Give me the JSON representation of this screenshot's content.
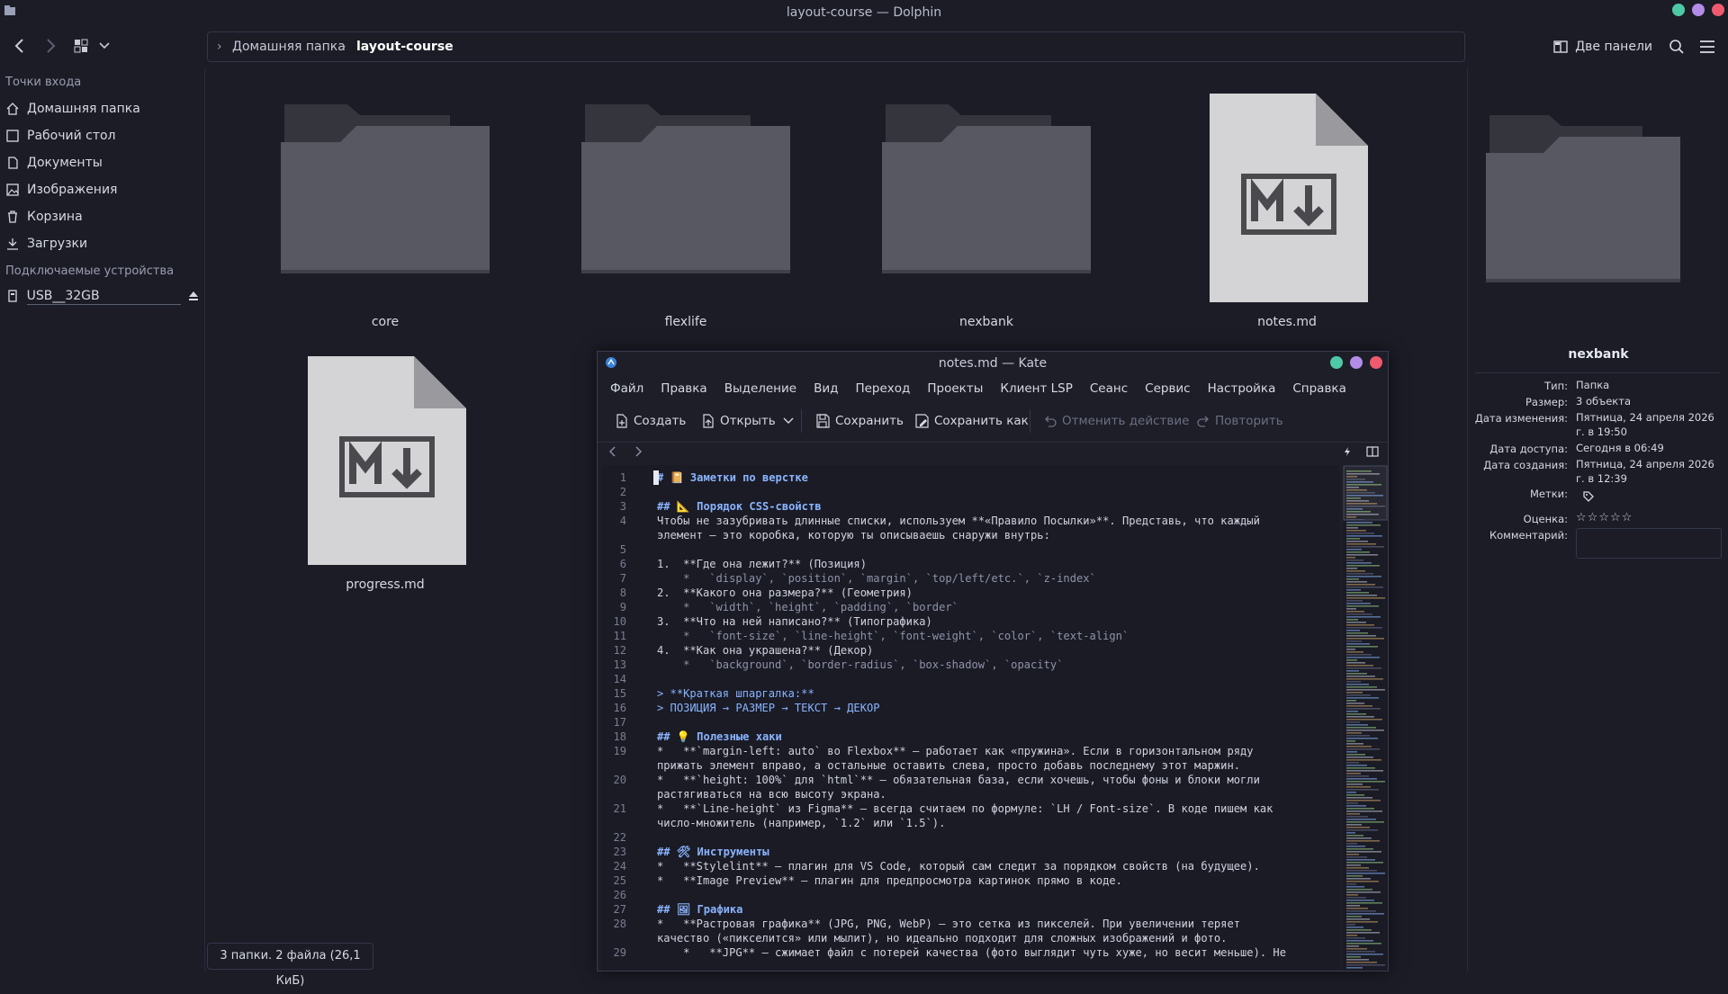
{
  "dolphin": {
    "title": "layout-course — Dolphin",
    "breadcrumb": [
      "Домашняя папка",
      "layout-course"
    ],
    "split_label": "Две панели",
    "sidebar": {
      "places_header": "Точки входа",
      "places": [
        "Домашняя папка",
        "Рабочий стол",
        "Документы",
        "Изображения",
        "Корзина",
        "Загрузки"
      ],
      "devices_header": "Подключаемые устройства",
      "devices": [
        "USB__32GB"
      ]
    },
    "files": [
      "core",
      "flexlife",
      "nexbank",
      "notes.md",
      "progress.md"
    ],
    "status": "3 папки. 2 файла (26,1 КиБ)",
    "info": {
      "name": "nexbank",
      "type_key": "Тип:",
      "type_val": "Папка",
      "size_key": "Размер:",
      "size_val": "3 объекта",
      "modified_key": "Дата изменения:",
      "modified_val": "Пятница, 24 апреля 2026 г. в 19:50",
      "accessed_key": "Дата доступа:",
      "accessed_val": "Сегодня в 06:49",
      "created_key": "Дата создания:",
      "created_val": "Пятница, 24 апреля 2026 г. в 12:39",
      "tags_key": "Метки:",
      "rating_key": "Оценка:",
      "rating": 0,
      "comment_key": "Комментарий:"
    }
  },
  "kate": {
    "title": "notes.md — Kate",
    "menu": [
      "Файл",
      "Правка",
      "Выделение",
      "Вид",
      "Переход",
      "Проекты",
      "Клиент LSP",
      "Сеанс",
      "Сервис",
      "Настройка",
      "Справка"
    ],
    "toolbar": {
      "new": "Создать",
      "open": "Открыть",
      "save": "Сохранить",
      "save_as": "Сохранить как",
      "undo": "Отменить действие",
      "redo": "Повторить"
    },
    "lines": [
      {
        "n": "1",
        "t": "# 📔 Заметки по верстке",
        "s": "h"
      },
      {
        "n": "2",
        "t": "",
        "s": ""
      },
      {
        "n": "3",
        "t": "## 📐 Порядок CSS-свойств",
        "s": "h"
      },
      {
        "n": "4",
        "t": "Чтобы не зазубривать длинные списки, используем **«Правило Посылки»**. Представь, что каждый",
        "s": ""
      },
      {
        "n": "",
        "t": "элемент — это коробка, которую ты описываешь снаружи внутрь:",
        "s": ""
      },
      {
        "n": "5",
        "t": "",
        "s": ""
      },
      {
        "n": "6",
        "t": "1.  **Где она лежит?** (Позиция)",
        "s": ""
      },
      {
        "n": "7",
        "t": "    *   `display`, `position`, `margin`, `top/left/etc.`, `z-index`",
        "s": "c"
      },
      {
        "n": "8",
        "t": "2.  **Какого она размера?** (Геометрия)",
        "s": ""
      },
      {
        "n": "9",
        "t": "    *   `width`, `height`, `padding`, `border`",
        "s": "c"
      },
      {
        "n": "10",
        "t": "3.  **Что на ней написано?** (Типографика)",
        "s": ""
      },
      {
        "n": "11",
        "t": "    *   `font-size`, `line-height`, `font-weight`, `color`, `text-align`",
        "s": "c"
      },
      {
        "n": "12",
        "t": "4.  **Как она украшена?** (Декор)",
        "s": ""
      },
      {
        "n": "13",
        "t": "    *   `background`, `border-radius`, `box-shadow`, `opacity`",
        "s": "c"
      },
      {
        "n": "14",
        "t": "",
        "s": ""
      },
      {
        "n": "15",
        "t": "> **Краткая шпаргалка:**",
        "s": "q"
      },
      {
        "n": "16",
        "t": "> ПОЗИЦИЯ → РАЗМЕР → ТЕКСТ → ДЕКОР",
        "s": "q"
      },
      {
        "n": "17",
        "t": "",
        "s": ""
      },
      {
        "n": "18",
        "t": "## 💡 Полезные хаки",
        "s": "h"
      },
      {
        "n": "19",
        "t": "*   **`margin-left: auto` во Flexbox** — работает как «пружина». Если в горизонтальном ряду",
        "s": ""
      },
      {
        "n": "",
        "t": "прижать элемент вправо, а остальные оставить слева, просто добавь последнему этот маржин.",
        "s": ""
      },
      {
        "n": "20",
        "t": "*   **`height: 100%` для `html`** — обязательная база, если хочешь, чтобы фоны и блоки могли",
        "s": ""
      },
      {
        "n": "",
        "t": "растягиваться на всю высоту экрана.",
        "s": ""
      },
      {
        "n": "21",
        "t": "*   **`Line-height` из Figma** — всегда считаем по формуле: `LH / Font-size`. В коде пишем как",
        "s": ""
      },
      {
        "n": "",
        "t": "число-множитель (например, `1.2` или `1.5`).",
        "s": ""
      },
      {
        "n": "22",
        "t": "",
        "s": ""
      },
      {
        "n": "23",
        "t": "## 🛠 Инструменты",
        "s": "h"
      },
      {
        "n": "24",
        "t": "*   **Stylelint** — плагин для VS Code, который сам следит за порядком свойств (на будущее).",
        "s": ""
      },
      {
        "n": "25",
        "t": "*   **Image Preview** — плагин для предпросмотра картинок прямо в коде.",
        "s": ""
      },
      {
        "n": "26",
        "t": "",
        "s": ""
      },
      {
        "n": "27",
        "t": "## 🖼 Графика",
        "s": "h"
      },
      {
        "n": "28",
        "t": "*   **Растровая графика** (JPG, PNG, WebP) — это сетка из пикселей. При увеличении теряет",
        "s": ""
      },
      {
        "n": "",
        "t": "качество («пикселится» или мылит), но идеально подходит для сложных изображений и фото.",
        "s": ""
      },
      {
        "n": "29",
        "t": "    *   **JPG** — сжимает файл с потерей качества (фото выглядит чуть хуже, но весит меньше). Не",
        "s": ""
      }
    ]
  },
  "colors": {
    "bg": "#1b1c26",
    "accent": "#8ab4ff",
    "btn_min": "#4ec9a6",
    "btn_max": "#b48ce8",
    "btn_close": "#ef5a6f"
  }
}
